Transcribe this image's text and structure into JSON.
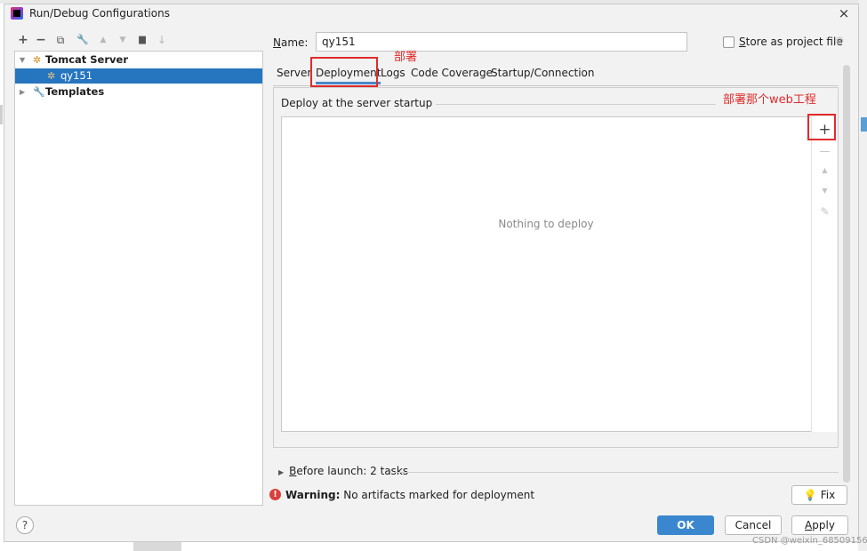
{
  "window": {
    "title": "Run/Debug Configurations",
    "close_glyph": "×"
  },
  "toolbar": {
    "icons": [
      {
        "name": "add-icon",
        "glyph": "+"
      },
      {
        "name": "remove-icon",
        "glyph": "−"
      },
      {
        "name": "copy-icon",
        "glyph": "⧉"
      },
      {
        "name": "wrench-icon",
        "glyph": "🔧"
      },
      {
        "name": "move-up-icon",
        "glyph": "▲"
      },
      {
        "name": "move-down-icon",
        "glyph": "▼"
      },
      {
        "name": "folder-icon",
        "glyph": "▆"
      },
      {
        "name": "sort-icon",
        "glyph": "↓"
      }
    ]
  },
  "tree": {
    "tomcat_label": "Tomcat Server",
    "config_label": "qy151",
    "templates_label": "Templates"
  },
  "config": {
    "name_label_key": "N",
    "name_label_rest": "ame:",
    "name_value": "qy151",
    "store_key": "S",
    "store_rest": "tore as project file"
  },
  "tabs": [
    "Server",
    "Deployment",
    "Logs",
    "Code Coverage",
    "Startup/Connection"
  ],
  "deployment": {
    "group_label": "Deploy at the server startup",
    "empty_text": "Nothing to deploy",
    "list_tools": {
      "add": "+",
      "remove": "—",
      "up": "▲",
      "down": "▼",
      "edit": "✎"
    }
  },
  "annotations": {
    "tab_note": "部署",
    "plus_note": "部署那个web工程"
  },
  "before_launch": {
    "key": "B",
    "rest": "efore launch: 2 tasks"
  },
  "warning": {
    "bold": "Warning:",
    "text": " No artifacts marked for deployment"
  },
  "buttons": {
    "fix": "Fix",
    "ok": "OK",
    "cancel": "Cancel",
    "apply_key": "A",
    "apply_rest": "pply",
    "help": "?"
  },
  "watermark": "CSDN @weixin_68509156",
  "colors": {
    "accent": "#3b87cf",
    "selection": "#2675bf",
    "annotation": "#e02b2b",
    "warning": "#d9403b"
  }
}
